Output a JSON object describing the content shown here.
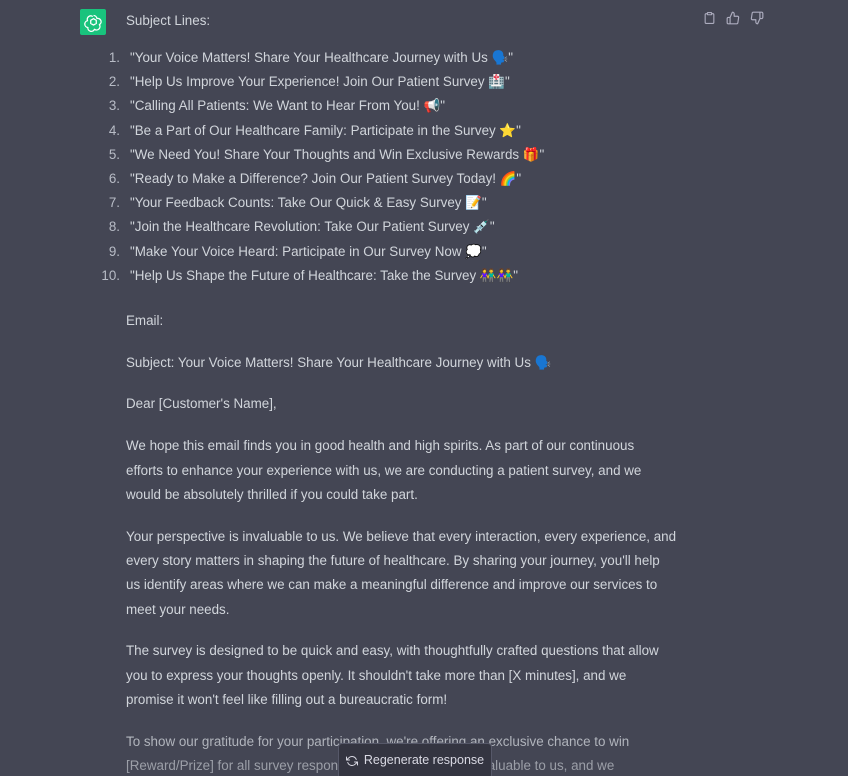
{
  "colors": {
    "background": "#444654",
    "text": "#d1d5db",
    "avatar": "#19c37d",
    "button_bg": "#343541"
  },
  "actions": {
    "copy_icon": "clipboard-icon",
    "thumbs_up_icon": "thumbs-up-icon",
    "thumbs_down_icon": "thumbs-down-icon"
  },
  "response": {
    "subject_heading": "Subject Lines:",
    "subject_lines": [
      {
        "num": "1.",
        "text": "\"Your Voice Matters! Share Your Healthcare Journey with Us 🗣️\""
      },
      {
        "num": "2.",
        "text": "\"Help Us Improve Your Experience! Join Our Patient Survey 🏥\""
      },
      {
        "num": "3.",
        "text": "\"Calling All Patients: We Want to Hear From You! 📢\""
      },
      {
        "num": "4.",
        "text": "\"Be a Part of Our Healthcare Family: Participate in the Survey ⭐\""
      },
      {
        "num": "5.",
        "text": "\"We Need You! Share Your Thoughts and Win Exclusive Rewards 🎁\""
      },
      {
        "num": "6.",
        "text": "\"Ready to Make a Difference? Join Our Patient Survey Today! 🌈\""
      },
      {
        "num": "7.",
        "text": "\"Your Feedback Counts: Take Our Quick & Easy Survey 📝\""
      },
      {
        "num": "8.",
        "text": "\"Join the Healthcare Revolution: Take Our Patient Survey 💉\""
      },
      {
        "num": "9.",
        "text": "\"Make Your Voice Heard: Participate in Our Survey Now 💭\""
      },
      {
        "num": "10.",
        "text": "\"Help Us Shape the Future of Healthcare: Take the Survey 👫👫\""
      }
    ],
    "email_heading": "Email:",
    "email_subject": "Subject: Your Voice Matters! Share Your Healthcare Journey with Us 🗣️",
    "greeting": "Dear [Customer's Name],",
    "paragraphs": [
      [
        "We hope this email finds you in good health and high spirits. As part of our continuous",
        "efforts to enhance your experience with us, we are conducting a patient survey, and we",
        "would be absolutely thrilled if you could take part."
      ],
      [
        "Your perspective is invaluable to us. We believe that every interaction, every experience, and",
        "every story matters in shaping the future of healthcare. By sharing your journey, you'll help",
        "us identify areas where we can make a meaningful difference and improve our services to",
        "meet your needs."
      ],
      [
        "The survey is designed to be quick and easy, with thoughtfully crafted questions that allow",
        "you to express your thoughts openly. It shouldn't take more than [X minutes], and we",
        "promise it won't feel like filling out a bureaucratic form!"
      ],
      [
        "To show our gratitude for your participation, we're offering an exclusive chance to win",
        "[Reward/Prize] for all survey respondents. Your insights are valuable to us, and we"
      ]
    ]
  },
  "regenerate": {
    "icon": "refresh-icon",
    "label": "Regenerate response"
  }
}
